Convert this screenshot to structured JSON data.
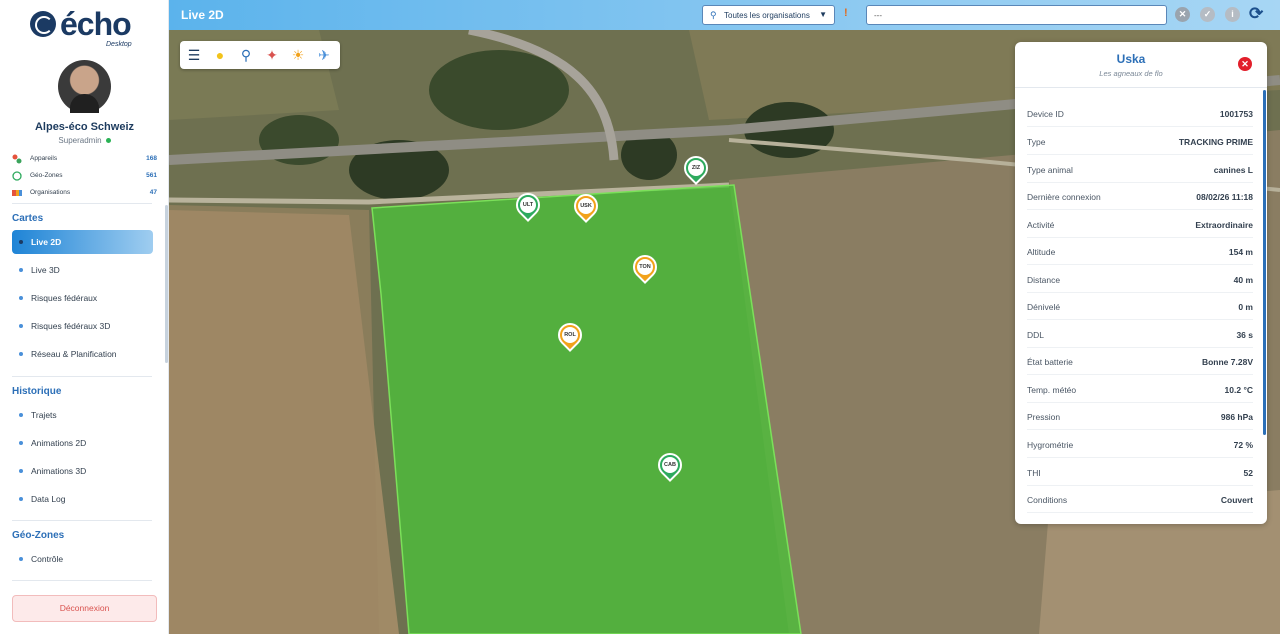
{
  "app": {
    "logo_text": "écho",
    "logo_sub": "Desktop",
    "org_name": "Alpes-éco Schweiz",
    "role": "Superadmin",
    "logout_label": "Déconnexion"
  },
  "stats": [
    {
      "label": "Appareils",
      "value": "168",
      "icon": "devices-icon"
    },
    {
      "label": "Géo-Zones",
      "value": "561",
      "icon": "geozone-icon"
    },
    {
      "label": "Organisations",
      "value": "47",
      "icon": "organizations-icon"
    }
  ],
  "sections": {
    "cartes": "Cartes",
    "historique": "Historique",
    "geozones": "Géo-Zones"
  },
  "nav": {
    "cartes": [
      "Live 2D",
      "Live 3D",
      "Risques fédéraux",
      "Risques fédéraux 3D",
      "Réseau & Planification"
    ],
    "historique": [
      "Trajets",
      "Animations 2D",
      "Animations 3D",
      "Data Log"
    ],
    "geozones": [
      "Contrôle"
    ]
  },
  "topbar": {
    "title": "Live 2D",
    "org_filter": "Toutes les organisations",
    "search_value": "---"
  },
  "map_tools": [
    "layers-icon",
    "lightbulb-icon",
    "search-zoom-icon",
    "hiker-icon",
    "weather-icon",
    "satellite-icon"
  ],
  "markers": [
    {
      "label": "ZIZ",
      "color": "#2eaa5e"
    },
    {
      "label": "ULT",
      "color": "#2eaa5e"
    },
    {
      "label": "USK",
      "color": "#f2a21b"
    },
    {
      "label": "TON",
      "color": "#f2a21b"
    },
    {
      "label": "ROL",
      "color": "#f2a21b"
    },
    {
      "label": "CAB",
      "color": "#2eaa5e"
    }
  ],
  "panel": {
    "title": "Uska",
    "subtitle": "Les agneaux de flo",
    "rows": [
      {
        "key": "Device ID",
        "value": "1001753"
      },
      {
        "key": "Type",
        "value": "TRACKING PRIME"
      },
      {
        "key": "Type animal",
        "value": "canines L"
      },
      {
        "key": "Dernière connexion",
        "value": "08/02/26 11:18"
      },
      {
        "key": "Activité",
        "value": "Extraordinaire"
      },
      {
        "key": "Altitude",
        "value": "154 m"
      },
      {
        "key": "Distance",
        "value": "40 m"
      },
      {
        "key": "Dénivelé",
        "value": "0 m"
      },
      {
        "key": "DDL",
        "value": "36 s"
      },
      {
        "key": "État batterie",
        "value": "Bonne 7.28V"
      },
      {
        "key": "Temp. météo",
        "value": "10.2 °C"
      },
      {
        "key": "Pression",
        "value": "986 hPa"
      },
      {
        "key": "Hygrométrie",
        "value": "72 %"
      },
      {
        "key": "THI",
        "value": "52"
      },
      {
        "key": "Conditions",
        "value": "Couvert"
      }
    ]
  },
  "colors": {
    "accent": "#2c6fb7",
    "geozone_fill": "#4cc13a",
    "active_nav": "#1e84d6"
  }
}
